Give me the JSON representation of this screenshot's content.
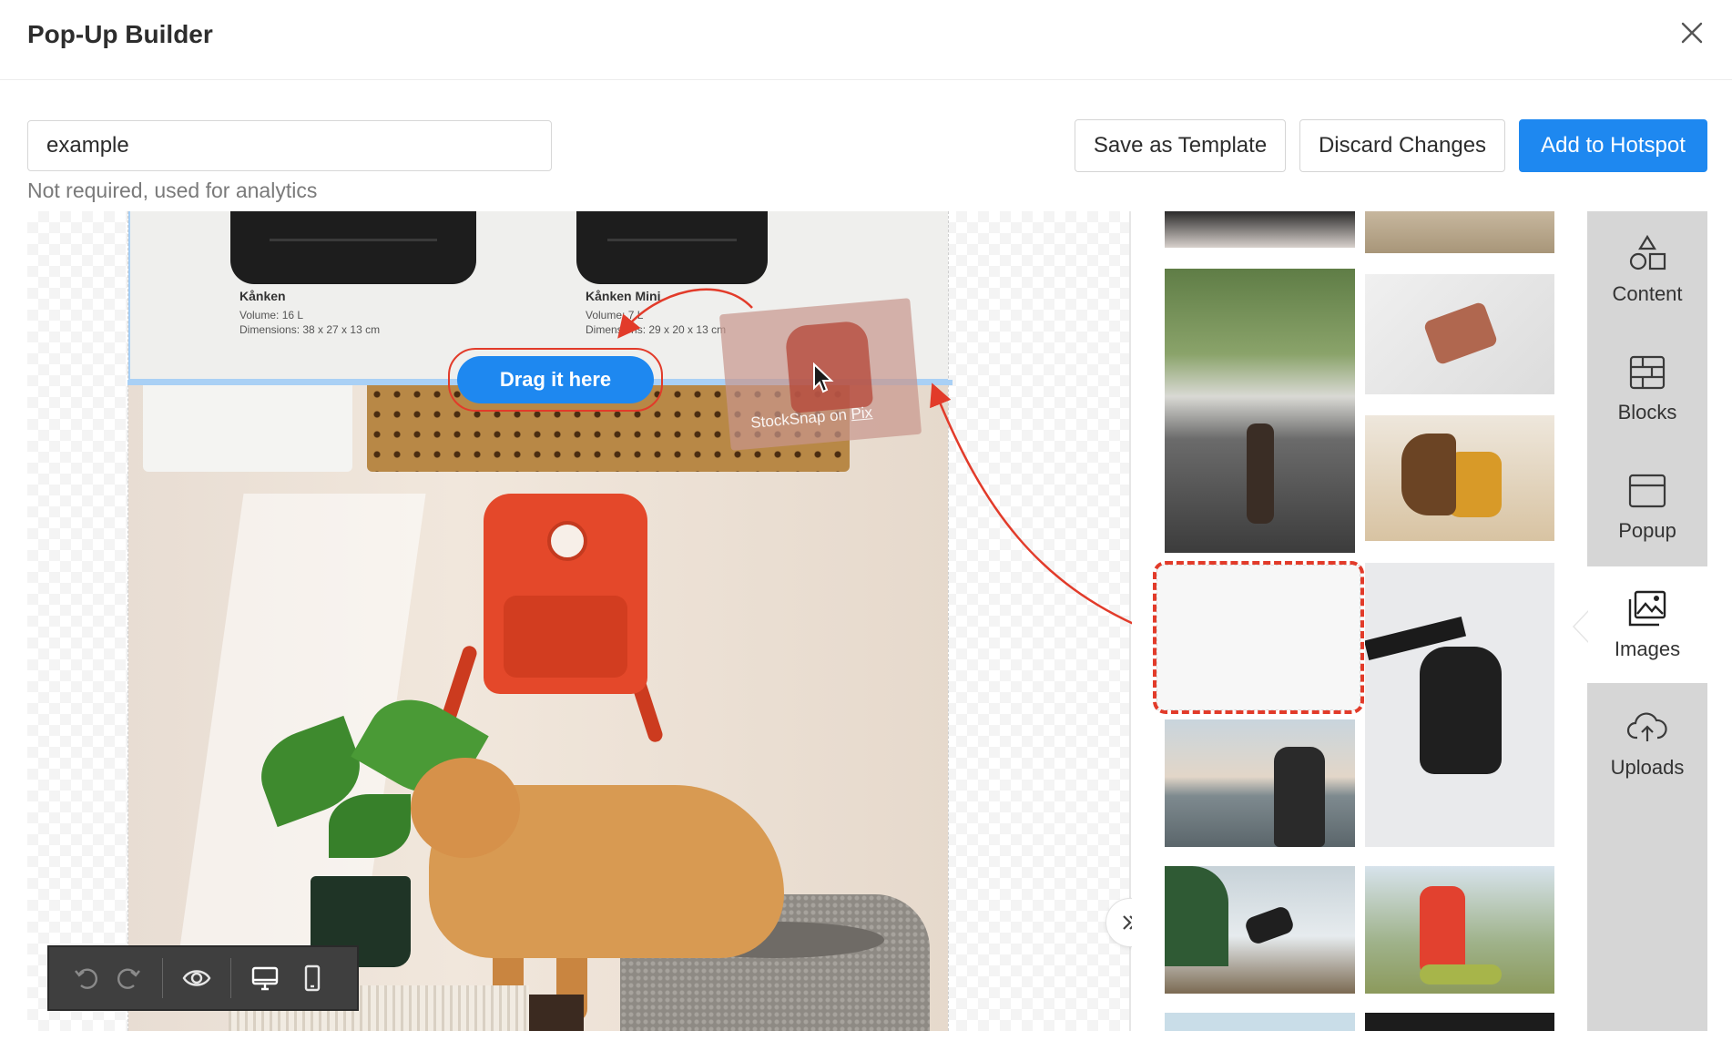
{
  "header": {
    "title": "Pop-Up Builder"
  },
  "name_field": {
    "value": "example",
    "hint": "Not required, used for analytics"
  },
  "actions": {
    "save_template": "Save as Template",
    "discard": "Discard Changes",
    "add_hotspot": "Add to Hotspot"
  },
  "products": [
    {
      "name": "Kånken",
      "volume": "Volume: 16 L",
      "dimensions": "Dimensions: 38 x 27 x 13 cm"
    },
    {
      "name": "Kånken Mini",
      "volume": "Volume: 7 L",
      "dimensions": "Dimensions: 29 x 20 x 13 cm"
    }
  ],
  "drag": {
    "pill_label": "Drag it here",
    "ghost_caption_prefix": "StockSnap on ",
    "ghost_caption_link": "Pix"
  },
  "side_tabs": [
    {
      "label": "Content",
      "icon": "shapes-icon"
    },
    {
      "label": "Blocks",
      "icon": "blocks-icon"
    },
    {
      "label": "Popup",
      "icon": "popup-icon"
    },
    {
      "label": "Images",
      "icon": "images-icon",
      "active": true
    },
    {
      "label": "Uploads",
      "icon": "cloud-upload-icon"
    }
  ],
  "toolbar": {
    "icons": [
      "undo-icon",
      "redo-icon",
      "eye-icon",
      "desktop-icon",
      "mobile-icon"
    ]
  },
  "colors": {
    "primary": "#1e88f0",
    "annotation": "#e23b2a",
    "rail": "#d6d6d6",
    "toolbar": "#3f3f3f"
  }
}
